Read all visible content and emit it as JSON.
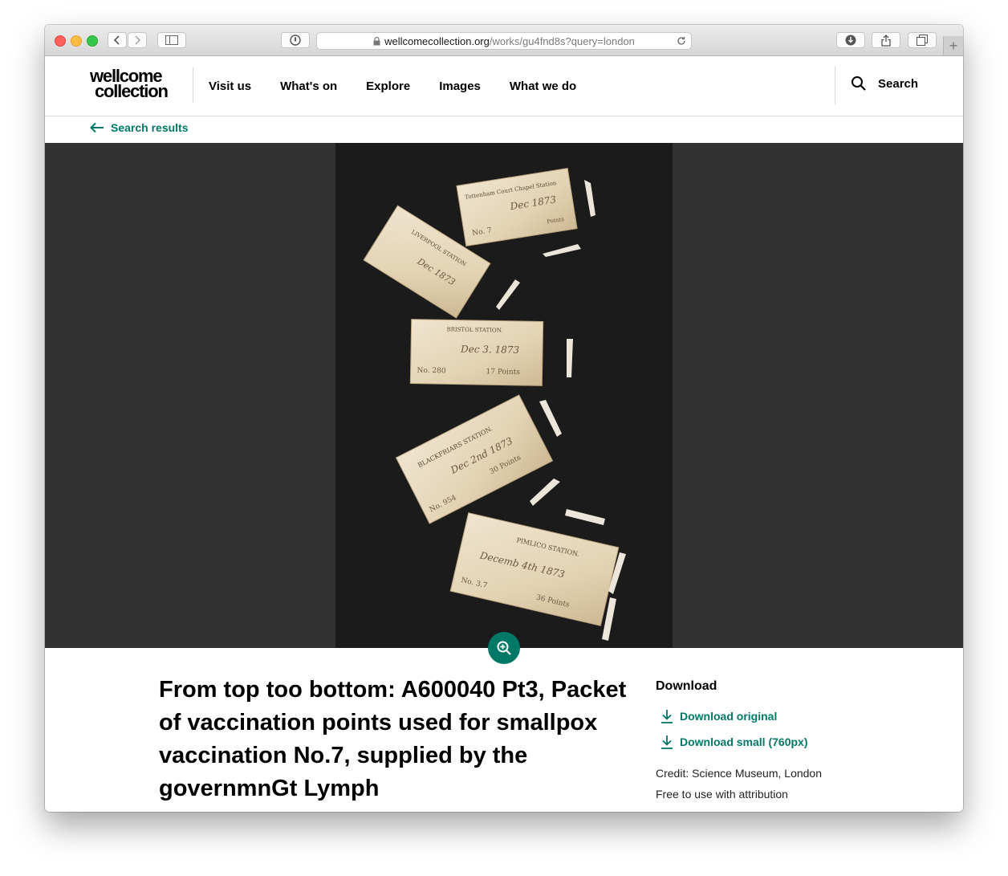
{
  "browser": {
    "url_host": "wellcomecollection.org",
    "url_path": "/works/gu4fnd8s?query=london"
  },
  "site": {
    "logo_line1": "wellcome",
    "logo_line2": "collection",
    "nav": [
      "Visit us",
      "What's on",
      "Explore",
      "Images",
      "What we do"
    ],
    "active_nav": "Images",
    "search_label": "Search"
  },
  "breadcrumb": {
    "back_label": "Search results"
  },
  "work": {
    "title": "From top too bottom: A600040 Pt3, Packet of vaccination points used for smallpox vaccination No.7, supplied by the governmnGt Lymph"
  },
  "download": {
    "heading": "Download",
    "original_label": "Download original",
    "small_label": "Download small (760px)",
    "credit": "Credit: Science Museum, London",
    "license": "Free to use with attribution"
  },
  "photo_labels": {
    "packet1_station": "Tottenham Court Chapel Station",
    "packet1_date": "Dec 1873",
    "packet1_no": "No. 7",
    "packet1_points": "Points",
    "packet2_station": "LIVERPOOL STATION",
    "packet2_date": "Dec 1873",
    "packet3_station": "BRISTOL STATION.",
    "packet3_date": "Dec 3. 1873",
    "packet3_no": "No. 280",
    "packet3_points": "17 Points",
    "packet4_station": "BLACKFRIARS STATION.",
    "packet4_date": "Dec 2nd 1873",
    "packet4_no": "No. 954",
    "packet4_points": "30 Points",
    "packet5_station": "PIMLICO STATION.",
    "packet5_date": "Decemb 4th 1873",
    "packet5_no": "No. 3.7",
    "packet5_points": "36 Points"
  },
  "colors": {
    "accent": "#007868",
    "nav_highlight": "#ffce3c",
    "viewer_bg": "#323232",
    "photo_bg": "#1b1b1c"
  },
  "icons": {
    "back": "arrow-left-icon",
    "search": "search-icon",
    "download": "download-icon",
    "zoom": "zoom-in-icon"
  }
}
